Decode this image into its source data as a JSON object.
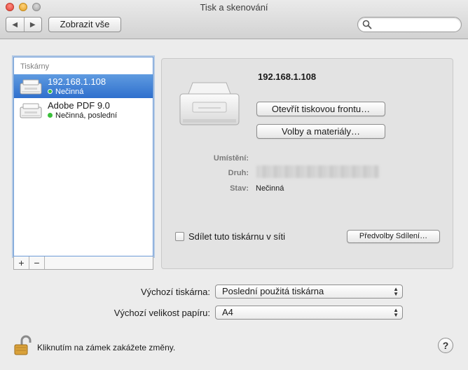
{
  "window": {
    "title": "Tisk a skenování"
  },
  "toolbar": {
    "back_glyph": "◀",
    "forward_glyph": "▶",
    "show_all_label": "Zobrazit vše",
    "search_value": "",
    "search_placeholder": ""
  },
  "printers": {
    "header": "Tiskárny",
    "items": [
      {
        "name": "192.168.1.108",
        "status": "Nečinná",
        "selected": true
      },
      {
        "name": "Adobe PDF 9.0",
        "status": "Nečinná, poslední",
        "selected": false
      }
    ],
    "add_label": "+",
    "remove_label": "−"
  },
  "detail": {
    "printer_name": "192.168.1.108",
    "open_queue_label": "Otevřít tiskovou frontu…",
    "options_label": "Volby a materiály…",
    "location_label": "Umístění:",
    "location_value": "",
    "kind_label": "Druh:",
    "status_label": "Stav:",
    "status_value": "Nečinná",
    "share_label": "Sdílet tuto tiskárnu v síti",
    "share_checked": false,
    "sharing_prefs_label": "Předvolby Sdílení…"
  },
  "defaults": {
    "printer_label": "Výchozí tiskárna:",
    "printer_value": "Poslední použitá tiskárna",
    "paper_label": "Výchozí velikost papíru:",
    "paper_value": "A4"
  },
  "footer": {
    "lock_text": "Kliknutím na zámek zakážete změny.",
    "help_label": "?"
  },
  "colors": {
    "selection": "#2f6fcd",
    "status_idle": "#3bbf3b"
  }
}
